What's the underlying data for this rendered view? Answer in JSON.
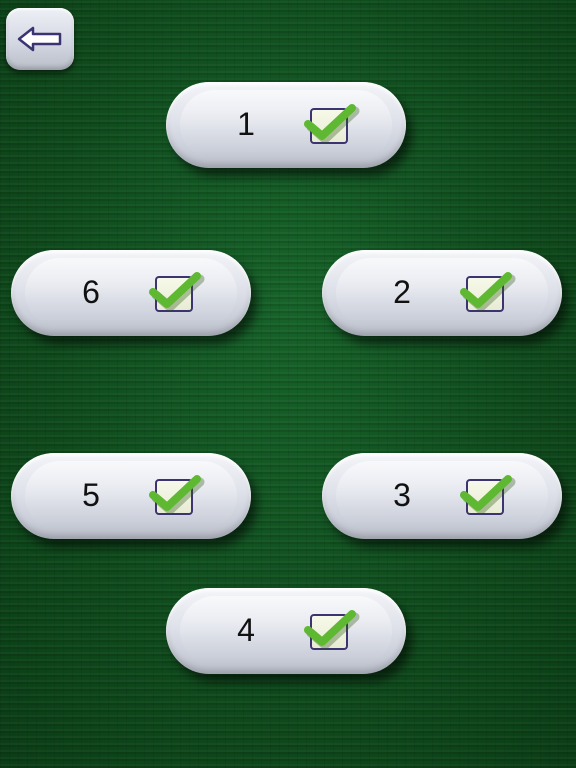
{
  "navigation": {
    "back_icon": "arrow-left-icon"
  },
  "items": [
    {
      "label": "1",
      "checked": true
    },
    {
      "label": "6",
      "checked": true
    },
    {
      "label": "2",
      "checked": true
    },
    {
      "label": "5",
      "checked": true
    },
    {
      "label": "3",
      "checked": true
    },
    {
      "label": "4",
      "checked": true
    }
  ],
  "colors": {
    "background": "#0f4a1c",
    "checkmark": "#5fb831",
    "checkbox_border": "#3b3470"
  }
}
